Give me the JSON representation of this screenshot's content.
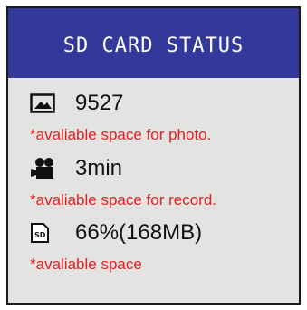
{
  "header": {
    "title": "SD CARD STATUS"
  },
  "rows": [
    {
      "icon": "photo-icon",
      "value": "9527",
      "note": "*avaliable space for photo."
    },
    {
      "icon": "video-camera-icon",
      "value": "3min",
      "note": "*avaliable space for record."
    },
    {
      "icon": "sd-card-icon",
      "value": "66%(168MB)",
      "note": "*avaliable space"
    }
  ],
  "colors": {
    "header_bg": "#33399b",
    "panel_bg": "#e3e3e2",
    "note_text": "#e4201f",
    "value_text": "#111111"
  }
}
